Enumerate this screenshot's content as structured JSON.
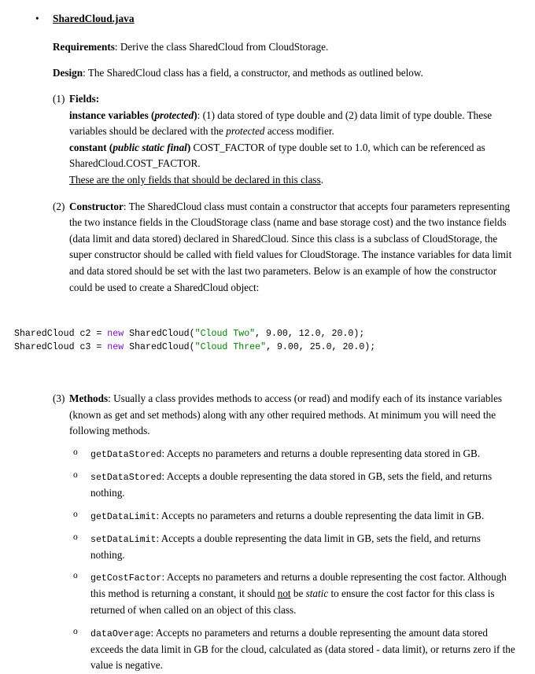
{
  "document": {
    "file_bullet": "•",
    "file_title": "SharedCloud.java",
    "requirements": {
      "label": "Requirements",
      "separator": ": ",
      "text": "Derive the class SharedCloud from CloudStorage."
    },
    "design": {
      "label": "Design",
      "separator": ":  ",
      "text": "The SharedCloud class has a field, a constructor, and methods as outlined below."
    },
    "sections": [
      {
        "number": "(1)",
        "heading": "Fields:",
        "lines": [
          {
            "lead_bold": "instance variables (",
            "lead_bold_italic": "protected",
            "lead_bold_close": ")",
            "rest": ": (1) data stored of type double and (2) data limit of type double.  These variables should be declared with the ",
            "italic_mid": "protected",
            "tail": " access modifier."
          },
          {
            "lead_bold": "constant (",
            "lead_bold_italic": "public static final",
            "lead_bold_close": ")",
            "rest": " COST_FACTOR of type double set to 1.0, which can be referenced as SharedCloud.COST_FACTOR.",
            "italic_mid": "",
            "tail": ""
          }
        ],
        "underlined_note": "These are the only fields that should be declared in this class",
        "underlined_note_tail": "."
      },
      {
        "number": "(2)",
        "heading": "Constructor",
        "heading_sep": ": ",
        "body": "The SharedCloud class must contain a constructor that accepts four parameters representing the two instance fields in the CloudStorage class (name and base storage cost) and the two instance fields (data limit and data stored) declared in SharedCloud.  Since this class is a subclass of CloudStorage, the super constructor should be called with field values for CloudStorage.  The instance variables for data limit and data stored should be set with the last two parameters.   Below is an example of how the constructor could be used to create a SharedCloud object:"
      },
      {
        "number": "(3)",
        "heading": "Methods",
        "heading_sep": ": ",
        "body": "Usually a class provides methods to access (or read) and modify each of its instance variables (known as get and set methods) along with any other required methods.  At minimum you will need the following methods."
      }
    ],
    "code_block": {
      "language": "java",
      "keyword_color": "#7f0fbf",
      "string_color": "#008000",
      "lines": [
        {
          "pre": "SharedCloud c2 = ",
          "keyword": "new",
          "mid": " SharedCloud(",
          "string": "\"Cloud Two\"",
          "post": ", 9.00, 12.0, 20.0);"
        },
        {
          "pre": "SharedCloud c3 = ",
          "keyword": "new",
          "mid": " SharedCloud(",
          "string": "\"Cloud Three\"",
          "post": ", 9.00, 25.0, 20.0);"
        }
      ]
    },
    "methods": {
      "bullet": "o",
      "items": [
        {
          "name": "getDataStored",
          "sep": ":  ",
          "desc": "Accepts no parameters and returns a double representing data stored in GB."
        },
        {
          "name": "setDataStored",
          "sep": ":  ",
          "desc": "Accepts a double representing the data stored in GB, sets the field, and returns nothing."
        },
        {
          "name": "getDataLimit",
          "sep": ":  ",
          "desc": "Accepts no parameters and returns a double representing the data limit in GB."
        },
        {
          "name": "setDataLimit",
          "sep": ":  ",
          "desc": "Accepts a double representing the data limit in GB, sets the field, and returns nothing."
        },
        {
          "name": "getCostFactor",
          "sep": ":  ",
          "desc_pre": "Accepts no parameters and returns a double representing the cost factor. Although this method is returning a constant, it should ",
          "desc_underline": "not",
          "desc_mid": " be ",
          "desc_italic": "static",
          "desc_post": " to ensure the cost factor for this class is returned of when called on an object of this class."
        },
        {
          "name": "dataOverage",
          "sep": ":  ",
          "desc": "Accepts no parameters and returns a double representing the amount data stored exceeds the data limit in GB for the cloud, calculated as (data stored - data limit), or returns zero if the value is negative."
        }
      ]
    }
  }
}
